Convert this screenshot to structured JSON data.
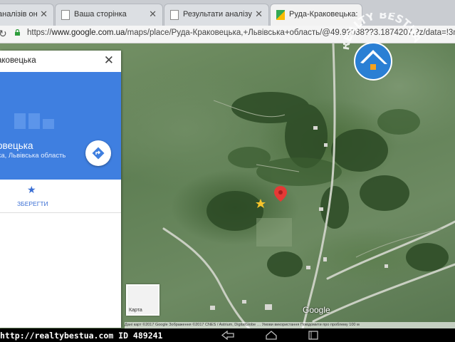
{
  "tabs": [
    {
      "title": "аналізів он…",
      "active": false,
      "icon": "page-icon"
    },
    {
      "title": "Ваша сторінка",
      "active": false,
      "icon": "page-icon"
    },
    {
      "title": "Результати аналізу",
      "active": false,
      "icon": "page-icon"
    },
    {
      "title": "Руда-Краковецька: Карт…",
      "active": true,
      "icon": "google-maps-icon"
    }
  ],
  "address": {
    "scheme": "https://",
    "host": "www.google.com.ua",
    "path": "/maps/place/Руда-Краковецька,+Львівська+область/@49.9?038??3.1874207,?z/data=!3m1"
  },
  "search": {
    "query": "аковецька"
  },
  "place": {
    "name": "овецька",
    "region": "ка, Львівська область"
  },
  "actions": {
    "save_label": "ЗБЕРЕГТИ"
  },
  "map": {
    "thumbnail_label": "Карта",
    "logo": "Google",
    "credits": "Дані карт ©2017 Google Зображення ©2017 CNES / Astrium, DigitalGlobe …  Умови використання   Повідомити про проблему   100 м"
  },
  "watermark": {
    "site": "http://realtybestua.com ID 489241",
    "logo_text": "REALTY BESTUA"
  },
  "colors": {
    "panel_blue": "#3f7fe0",
    "accent_blue": "#3b6fd4",
    "pin_red": "#e53935"
  }
}
